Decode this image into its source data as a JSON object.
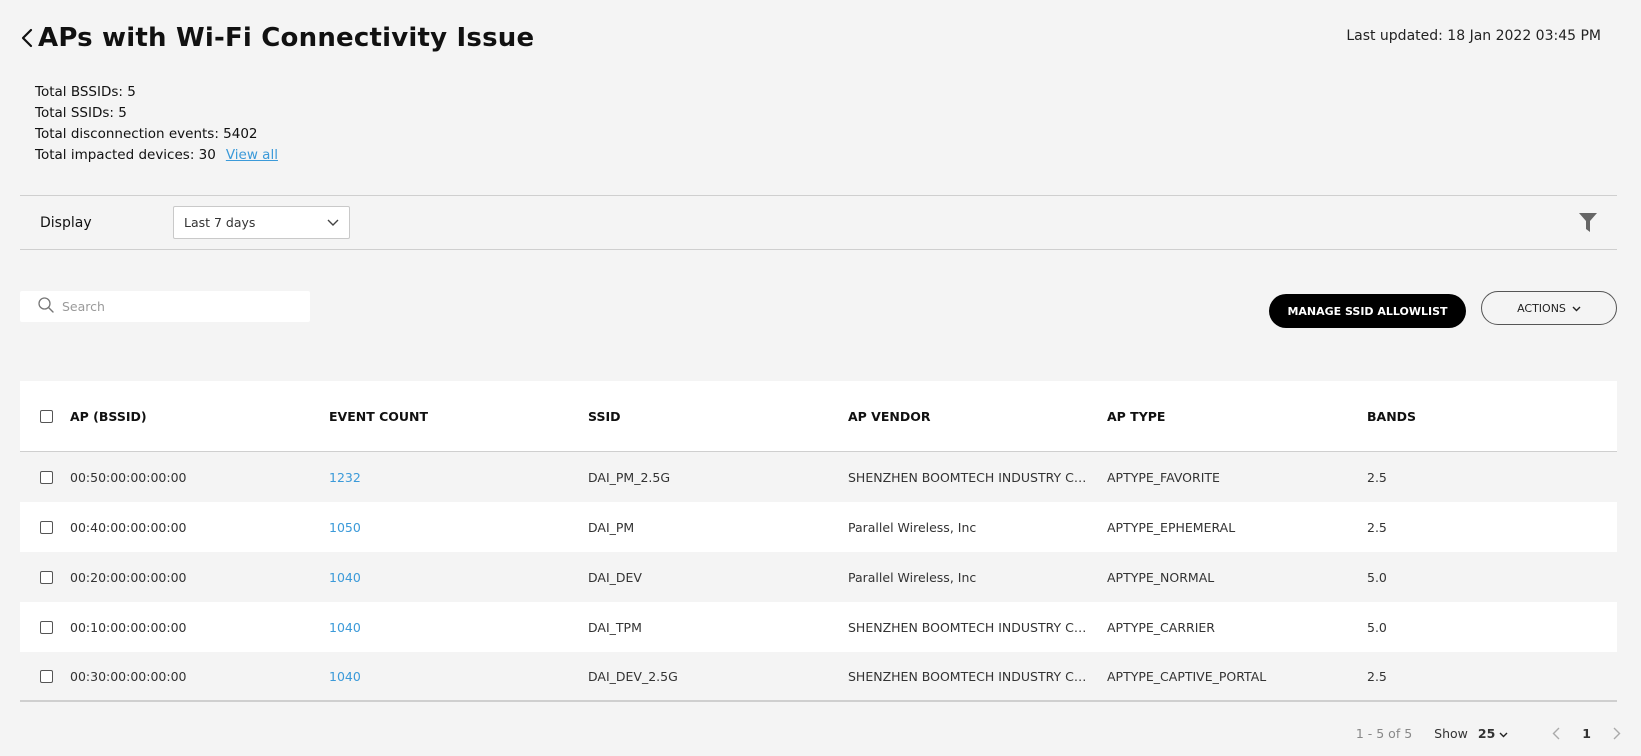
{
  "header": {
    "title": "APs with Wi-Fi Connectivity Issue",
    "last_updated": "Last updated: 18 Jan 2022 03:45 PM"
  },
  "summary": {
    "total_bssids": "Total BSSIDs: 5",
    "total_ssids": "Total SSIDs: 5",
    "total_disconnection_events": "Total disconnection events: 5402",
    "total_impacted_devices": "Total impacted devices: 30",
    "view_all": "View all"
  },
  "display": {
    "label": "Display",
    "selected_period": "Last 7 days"
  },
  "search": {
    "placeholder": "Search",
    "value": ""
  },
  "toolbar": {
    "manage_label": "MANAGE SSID ALLOWLIST",
    "actions_label": "ACTIONS"
  },
  "table": {
    "columns": [
      "AP (BSSID)",
      "EVENT COUNT",
      "SSID",
      "AP VENDOR",
      "AP TYPE",
      "BANDS"
    ],
    "rows": [
      {
        "bssid": "00:50:00:00:00:00",
        "event_count": "1232",
        "ssid": "DAI_PM_2.5G",
        "vendor": "SHENZHEN BOOMTECH INDUSTRY CO.,L...",
        "type": "APTYPE_FAVORITE",
        "bands": "2.5"
      },
      {
        "bssid": "00:40:00:00:00:00",
        "event_count": "1050",
        "ssid": "DAI_PM",
        "vendor": "Parallel Wireless, Inc",
        "type": "APTYPE_EPHEMERAL",
        "bands": "2.5"
      },
      {
        "bssid": "00:20:00:00:00:00",
        "event_count": "1040",
        "ssid": "DAI_DEV",
        "vendor": "Parallel Wireless, Inc",
        "type": "APTYPE_NORMAL",
        "bands": "5.0"
      },
      {
        "bssid": "00:10:00:00:00:00",
        "event_count": "1040",
        "ssid": "DAI_TPM",
        "vendor": "SHENZHEN BOOMTECH INDUSTRY CO.,L...",
        "type": "APTYPE_CARRIER",
        "bands": "5.0"
      },
      {
        "bssid": "00:30:00:00:00:00",
        "event_count": "1040",
        "ssid": "DAI_DEV_2.5G",
        "vendor": "SHENZHEN BOOMTECH INDUSTRY CO.,L...",
        "type": "APTYPE_CAPTIVE_PORTAL",
        "bands": "2.5"
      }
    ]
  },
  "pagination": {
    "range": "1 - 5 of 5",
    "show_label": "Show",
    "page_size": "25",
    "current_page": "1"
  },
  "icons": [
    "chevron-left-icon",
    "chevron-down-icon",
    "filter-icon",
    "search-icon",
    "chevron-right-icon"
  ]
}
